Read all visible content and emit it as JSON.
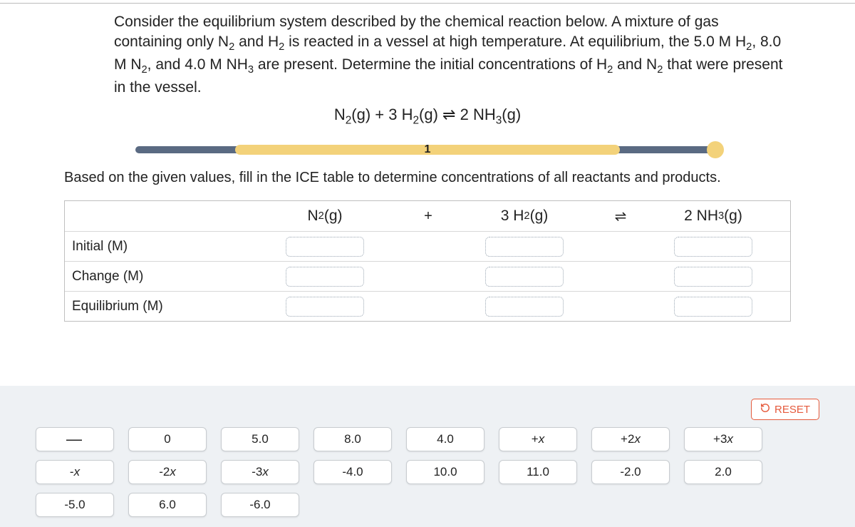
{
  "problem": {
    "text_html": "Consider the equilibrium system described by the chemical reaction below. A mixture of gas containing only N<sub>2</sub> and H<sub>2</sub> is reacted in a vessel at high temperature. At equilibrium, the 5.0 M H<sub>2</sub>, 8.0 M N<sub>2</sub>, and 4.0 M NH<sub>3</sub> are present. Determine the initial concentrations of H<sub>2</sub> and N<sub>2</sub> that were present in the vessel.",
    "equation_html": "N<sub>2</sub>(g) + 3 H<sub>2</sub>(g) ⇌ 2 NH<sub>3</sub>(g)"
  },
  "progress": {
    "step_label": "1"
  },
  "subprompt": "Based on the given values, fill in the ICE table to determine concentrations of all reactants and products.",
  "ice": {
    "col_headers": {
      "n2_html": "N<sub>2</sub>(g)",
      "plus": "+",
      "h2_html": "3 H<sub>2</sub>(g)",
      "eq": "⇌",
      "nh3_html": "2 NH<sub>3</sub>(g)"
    },
    "row_labels": {
      "initial": "Initial (M)",
      "change": "Change (M)",
      "equilibrium": "Equilibrium (M)"
    }
  },
  "reset_label": "RESET",
  "tiles": {
    "row1": [
      "―",
      "0",
      "5.0",
      "8.0",
      "4.0",
      "+x",
      "+2x",
      "+3x"
    ],
    "row2": [
      "-x",
      "-2x",
      "-3x",
      "-4.0",
      "10.0",
      "11.0",
      "-2.0",
      "2.0"
    ],
    "row3": [
      "-5.0",
      "6.0",
      "-6.0"
    ]
  }
}
